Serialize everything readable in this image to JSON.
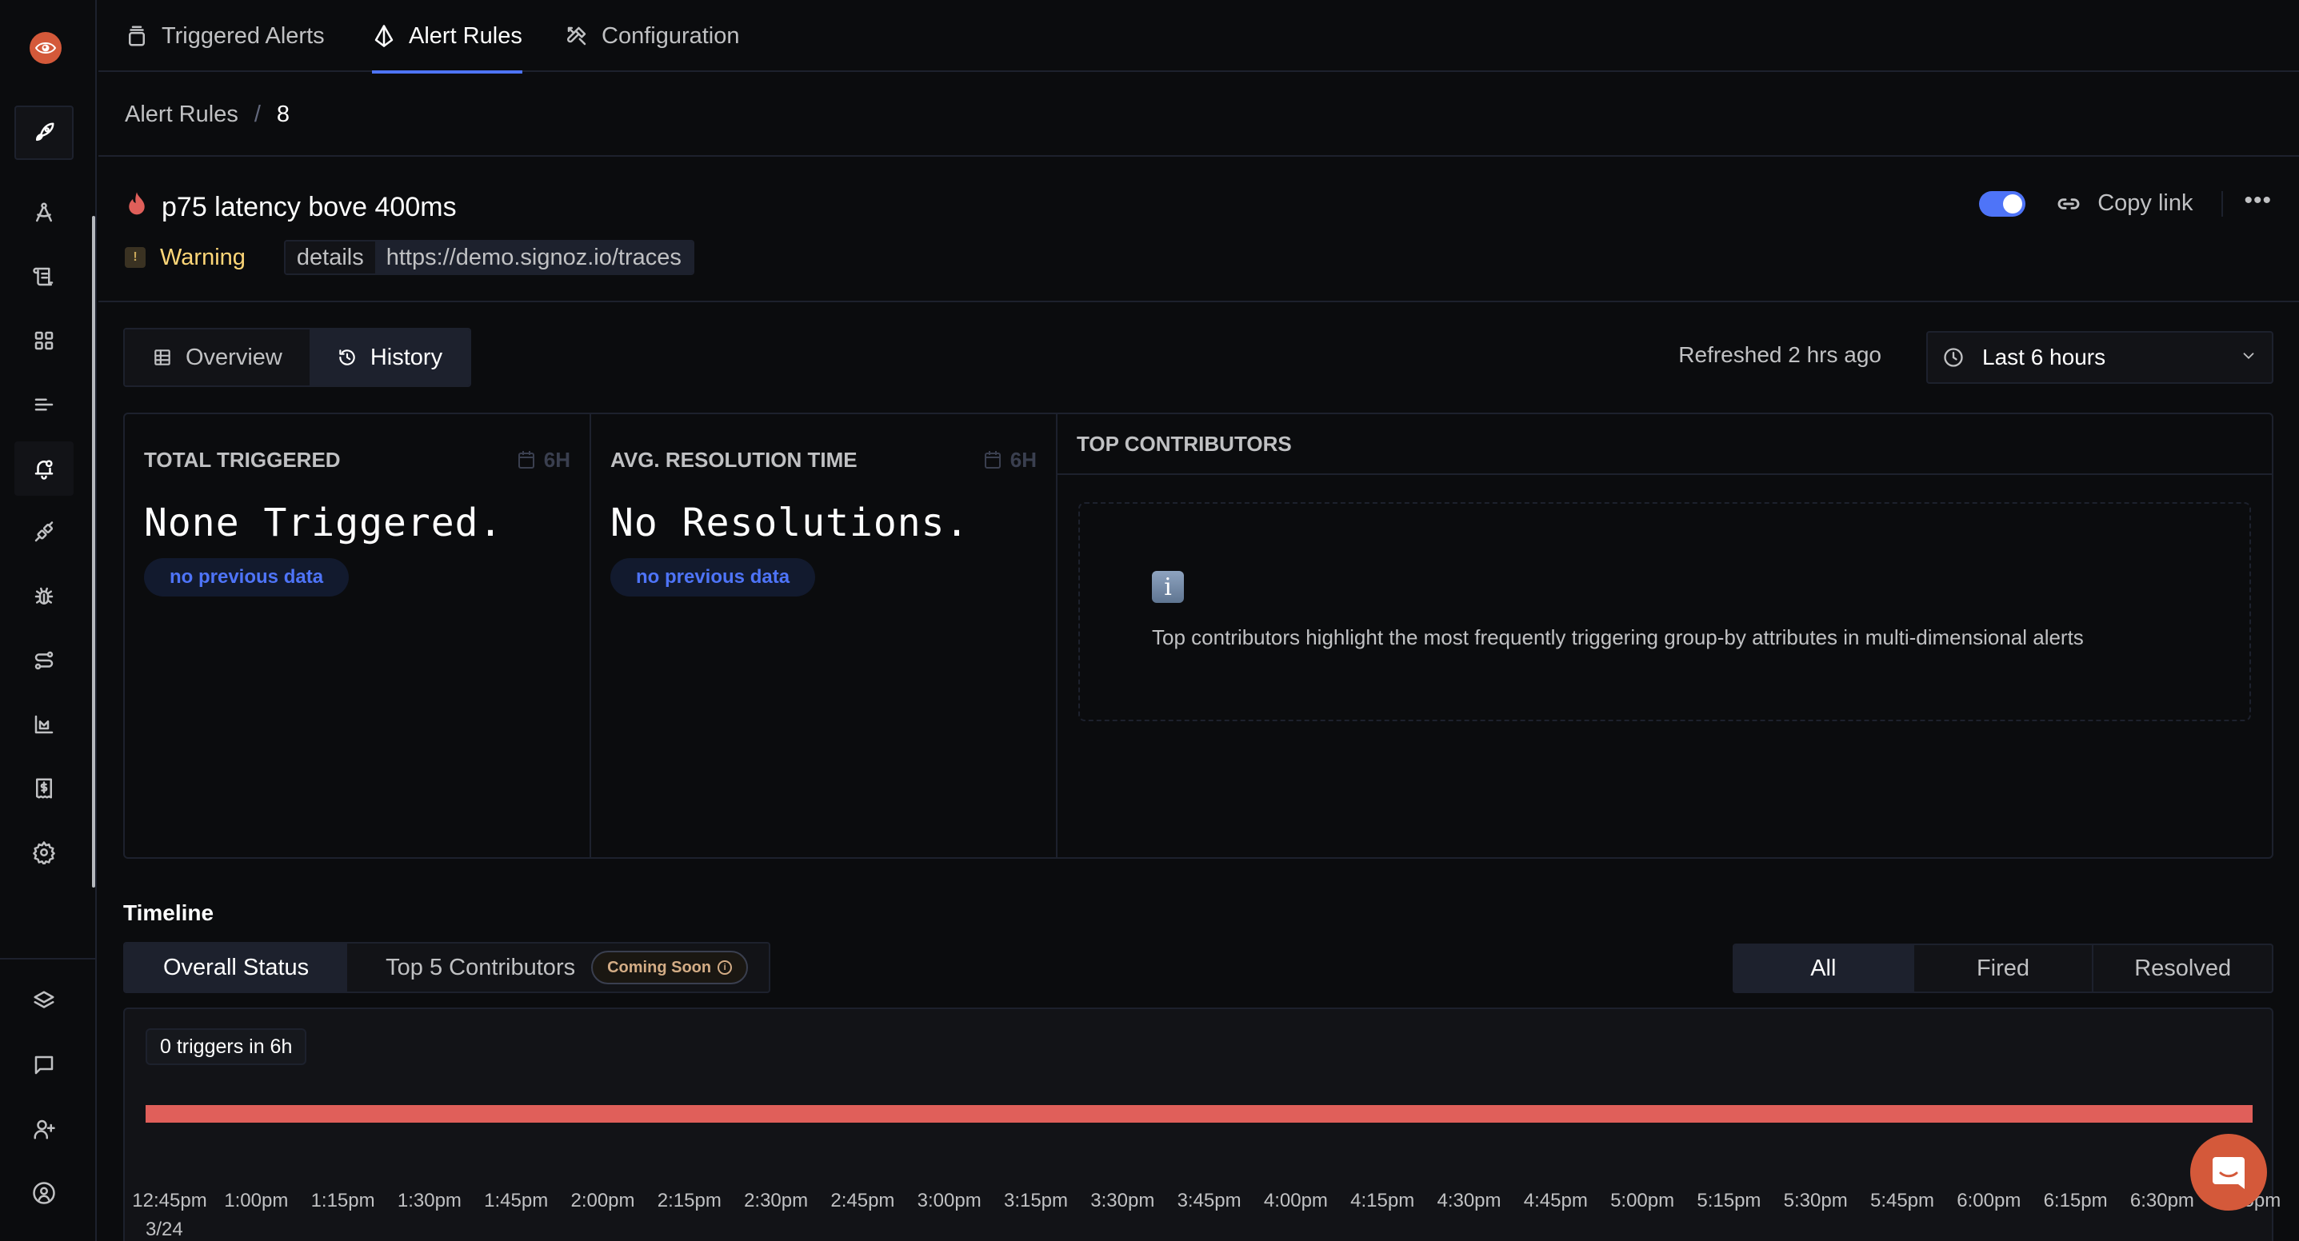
{
  "app": {
    "brand_icon": "signoz-eye-icon"
  },
  "sidebar": {
    "items": [
      {
        "name": "get-started",
        "icon": "rocket-icon"
      },
      {
        "name": "services",
        "icon": "compass-icon"
      },
      {
        "name": "logs",
        "icon": "scroll-icon"
      },
      {
        "name": "dashboards",
        "icon": "grid-icon"
      },
      {
        "name": "traces-explorer",
        "icon": "align-left-icon"
      },
      {
        "name": "alerts",
        "icon": "bell-dot-icon",
        "active": true
      },
      {
        "name": "integrations",
        "icon": "plug-icon"
      },
      {
        "name": "exceptions",
        "icon": "bug-icon"
      },
      {
        "name": "service-map",
        "icon": "route-icon"
      },
      {
        "name": "usage",
        "icon": "area-chart-icon"
      },
      {
        "name": "billing",
        "icon": "receipt-icon"
      },
      {
        "name": "settings",
        "icon": "gear-icon"
      }
    ],
    "bottom_items": [
      {
        "name": "workspace",
        "icon": "layers-icon"
      },
      {
        "name": "feedback",
        "icon": "message-square-icon"
      },
      {
        "name": "invite-members",
        "icon": "user-plus-icon"
      },
      {
        "name": "profile",
        "icon": "user-circle-icon"
      }
    ]
  },
  "top_tabs": [
    {
      "label": "Triggered Alerts",
      "icon": "cylinder-stack-icon"
    },
    {
      "label": "Alert Rules",
      "icon": "pyramid-icon",
      "active": true
    },
    {
      "label": "Configuration",
      "icon": "tools-icon"
    }
  ],
  "breadcrumb": {
    "parent": "Alert Rules",
    "separator": "/",
    "current": "8"
  },
  "alert": {
    "title": "p75 latency bove 400ms",
    "severity": "Warning",
    "severity_mark": "!",
    "label_key": "details",
    "label_value": "https://demo.signoz.io/traces",
    "enabled": true,
    "copy_link": "Copy link",
    "more": "•••"
  },
  "view_tabs": [
    {
      "label": "Overview",
      "icon": "table-icon"
    },
    {
      "label": "History",
      "icon": "history-icon",
      "active": true
    }
  ],
  "refresh_text": "Refreshed 2 hrs ago",
  "time_range": {
    "selected": "Last 6 hours"
  },
  "stats": {
    "total_triggered": {
      "title": "TOTAL TRIGGERED",
      "range": "6H",
      "value": "None Triggered.",
      "chip": "no previous data"
    },
    "avg_resolution": {
      "title": "AVG. RESOLUTION TIME",
      "range": "6H",
      "value": "No Resolutions.",
      "chip": "no previous data"
    },
    "top_contributors": {
      "title": "TOP CONTRIBUTORS",
      "info_glyph": "i",
      "empty_text": "Top contributors highlight the most frequently triggering group-by attributes in multi-dimensional alerts"
    }
  },
  "timeline": {
    "title": "Timeline",
    "tabs": [
      {
        "label": "Overall Status",
        "active": true
      },
      {
        "label": "Top 5 Contributors",
        "badge": "Coming Soon",
        "badge_icon": "info-circle-icon"
      }
    ],
    "filters": [
      {
        "label": "All",
        "active": true
      },
      {
        "label": "Fired"
      },
      {
        "label": "Resolved"
      }
    ],
    "summary": "0 triggers in 6h",
    "status_color": "#e05f5a",
    "date": "3/24",
    "ticks": [
      "12:45pm",
      "1:00pm",
      "1:15pm",
      "1:30pm",
      "1:45pm",
      "2:00pm",
      "2:15pm",
      "2:30pm",
      "2:45pm",
      "3:00pm",
      "3:15pm",
      "3:30pm",
      "3:45pm",
      "4:00pm",
      "4:15pm",
      "4:30pm",
      "4:45pm",
      "5:00pm",
      "5:15pm",
      "5:30pm",
      "5:45pm",
      "6:00pm",
      "6:15pm",
      "6:30pm",
      "6:45pm"
    ]
  },
  "colors": {
    "accent": "#4e74f8",
    "brand": "#d4593a",
    "warning": "#ffd778",
    "danger": "#e05f5a"
  }
}
